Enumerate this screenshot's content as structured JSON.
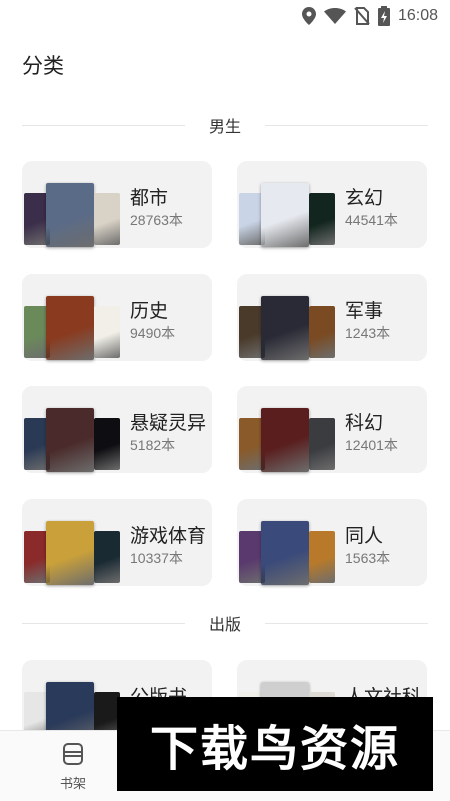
{
  "status": {
    "time": "16:08"
  },
  "page_title": "分类",
  "sections": [
    {
      "label": "男生"
    },
    {
      "label": "出版"
    }
  ],
  "male_categories": [
    {
      "name": "都市",
      "count": "28763本",
      "colors": [
        "#3b2e4a",
        "#d9d2c6",
        "#5a6b88"
      ]
    },
    {
      "name": "玄幻",
      "count": "44541本",
      "colors": [
        "#c9d4e6",
        "#12251e",
        "#e6e9ef"
      ]
    },
    {
      "name": "历史",
      "count": "9490本",
      "colors": [
        "#6b8a5a",
        "#f1efe8",
        "#8a3a1e"
      ]
    },
    {
      "name": "军事",
      "count": "1243本",
      "colors": [
        "#4a3a2a",
        "#7a4a22",
        "#2a2a36"
      ]
    },
    {
      "name": "悬疑灵异",
      "count": "5182本",
      "colors": [
        "#2a3a55",
        "#0e0e12",
        "#4a2a2a"
      ]
    },
    {
      "name": "科幻",
      "count": "12401本",
      "colors": [
        "#8a5a2a",
        "#3a3c40",
        "#5a1e1e"
      ]
    },
    {
      "name": "游戏体育",
      "count": "10337本",
      "colors": [
        "#8a2a2a",
        "#1a2a33",
        "#c9a03a"
      ]
    },
    {
      "name": "同人",
      "count": "1563本",
      "colors": [
        "#5a3a6e",
        "#b87a2a",
        "#3a4a7a"
      ]
    }
  ],
  "publish_categories": [
    {
      "name": "公版书",
      "colors": [
        "#e6e6e6",
        "#1a1a1a",
        "#2a3a5a"
      ]
    },
    {
      "name": "人文社科",
      "colors": [
        "#f0efea",
        "#dcdad2",
        "#cfcfcf"
      ]
    }
  ],
  "bottom_nav": {
    "bookshelf_label": "书架"
  },
  "watermark": {
    "text": "下载鸟资源"
  }
}
